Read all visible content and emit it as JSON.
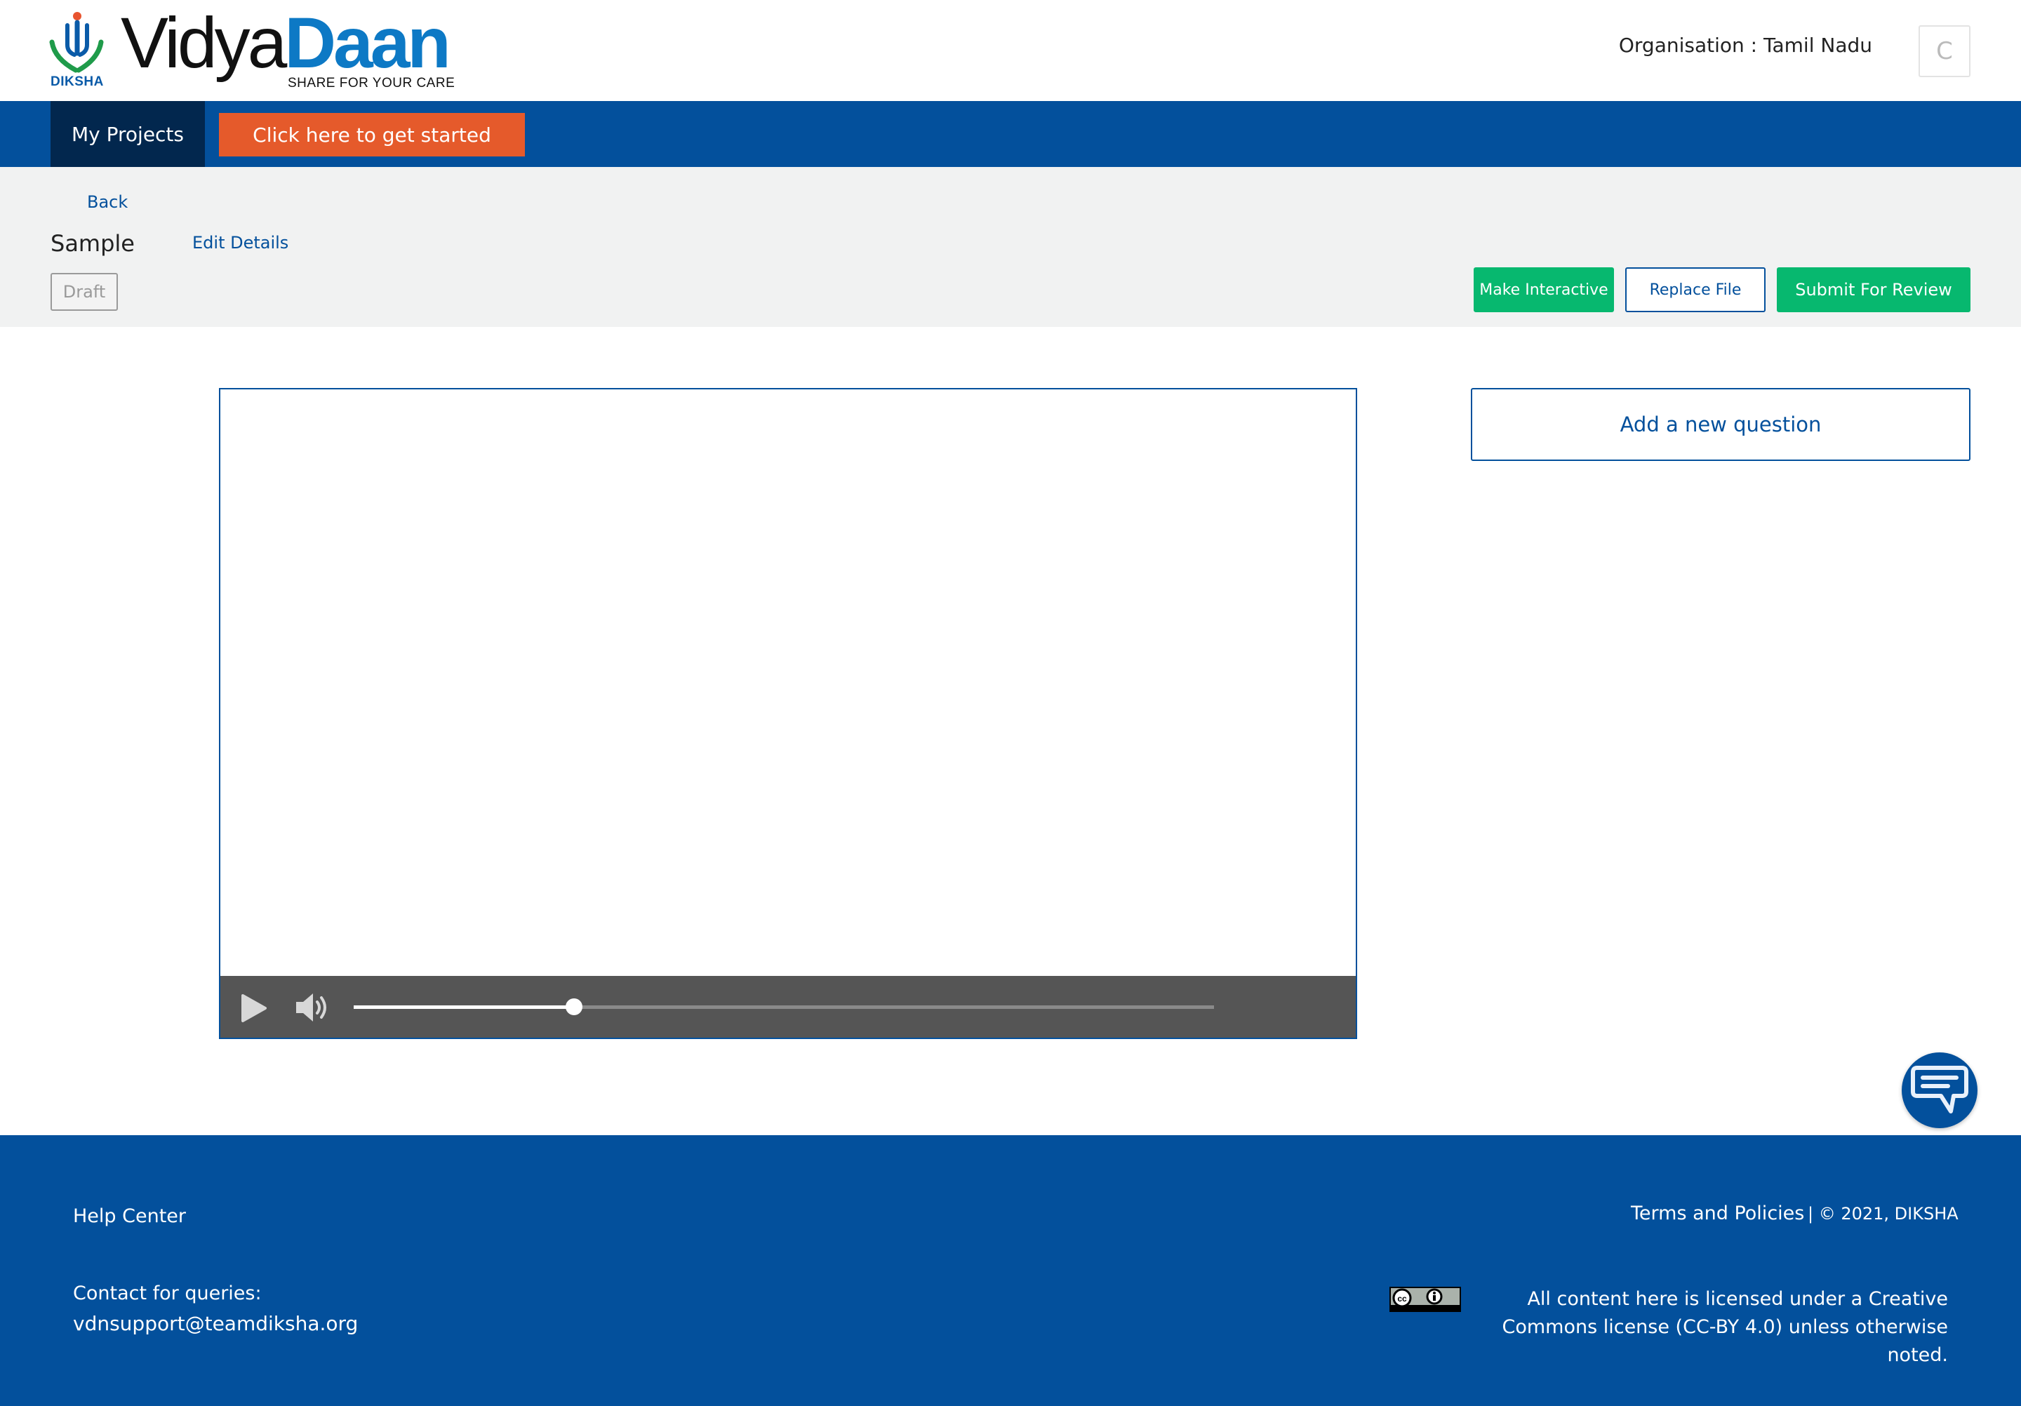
{
  "header": {
    "logo": {
      "mark_label": "DIKSHA",
      "word_part1": "Vidya",
      "word_part2": "Daan",
      "tagline": "SHARE FOR YOUR CARE"
    },
    "organisation": "Organisation : Tamil Nadu",
    "avatar_initial": "C"
  },
  "nav": {
    "tab_label": "My Projects",
    "cta_label": "Click here to get started"
  },
  "content": {
    "back_label": "Back",
    "title": "Sample",
    "edit_label": "Edit Details",
    "status": "Draft",
    "actions": {
      "make_interactive": "Make Interactive",
      "replace_file": "Replace File",
      "submit": "Submit For Review"
    }
  },
  "player": {
    "progress": 0.256
  },
  "side_panel": {
    "add_question": "Add a new question"
  },
  "footer": {
    "help": "Help Center",
    "contact_label": "Contact for queries:",
    "contact_email": "vdnsupport@teamdiksha.org",
    "terms": "Terms and Policies",
    "copyright": "| © 2021, DIKSHA",
    "license": "All content here is licensed under a Creative Commons license (CC-BY 4.0) unless otherwise noted."
  },
  "colors": {
    "primary": "#03509c",
    "nav_active": "#02274e",
    "cta": "#e55a2b",
    "success": "#07b86f",
    "subheader_bg": "#f1f2f2",
    "player_controls": "#555555"
  }
}
